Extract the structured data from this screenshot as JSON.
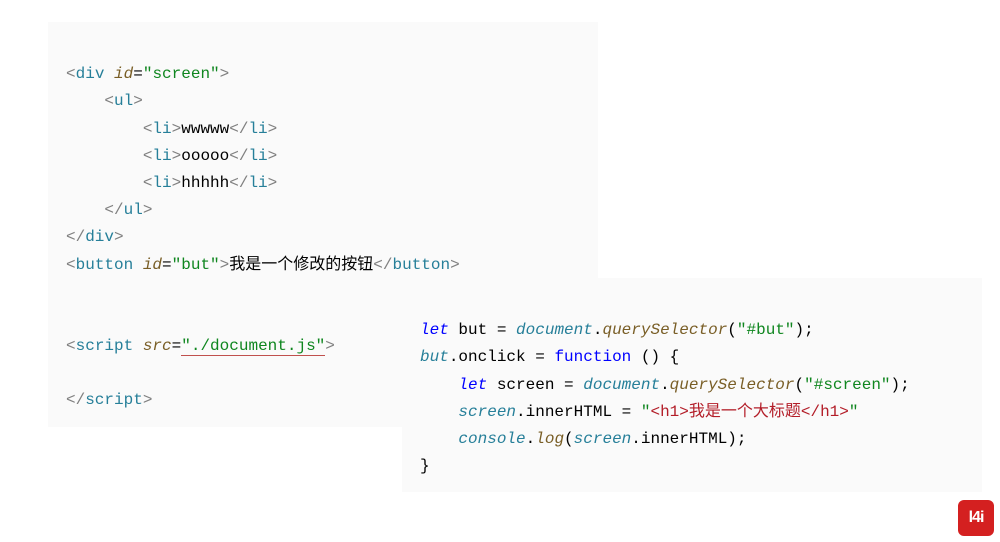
{
  "block_a": {
    "l1_tag_open": "div",
    "l1_attr": "id",
    "l1_val": "\"screen\"",
    "l2_tag": "ul",
    "li_tag": "li",
    "li1": "wwwww",
    "li2": "ooooo",
    "li3": "hhhhh",
    "l7_tag_close": "ul",
    "l8_tag_close": "div",
    "l9_tag": "button",
    "l9_attr": "id",
    "l9_val": "\"but\"",
    "l9_text": "我是一个修改的按钮",
    "l11_tag": "script",
    "l11_attr": "src",
    "l11_val": "\"./document.js\"",
    "l13_tag_close": "script"
  },
  "block_b": {
    "kw_let": "let",
    "var_but": "but",
    "obj_document": "document",
    "m_qs": "querySelector",
    "s_sel_but": "\"#but\"",
    "m_onclick": "onclick",
    "kw_function": "function",
    "var_screen": "screen",
    "s_sel_screen": "\"#screen\"",
    "m_innerHTML": "innerHTML",
    "s_html_open": "\"",
    "s_html_inner": "<h1>我是一个大标题</h1>",
    "s_html_close": "\"",
    "obj_console": "console",
    "m_log": "log"
  },
  "logo_text": "l4i"
}
